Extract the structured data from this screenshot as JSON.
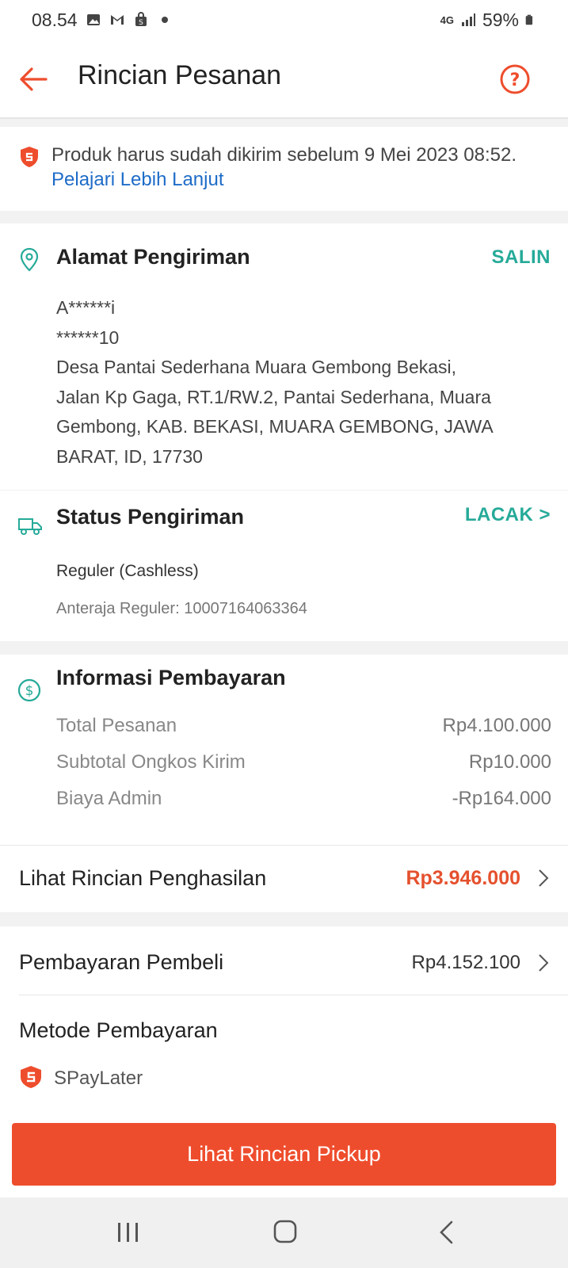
{
  "status_bar": {
    "time": "08.54",
    "network": "4G",
    "battery": "59%"
  },
  "header": {
    "title": "Rincian Pesanan"
  },
  "notice": {
    "text": "Produk harus sudah dikirim sebelum 9 Mei 2023 08:52.",
    "link": "Pelajari Lebih Lanjut"
  },
  "address": {
    "title": "Alamat Pengiriman",
    "action": "SALIN",
    "name": "A******i",
    "phone": "******10",
    "line1": "Desa Pantai Sederhana Muara Gembong Bekasi,",
    "line2": "Jalan Kp Gaga, RT.1/RW.2, Pantai Sederhana, Muara",
    "line3": "Gembong, KAB. BEKASI, MUARA GEMBONG, JAWA",
    "line4": "BARAT, ID, 17730"
  },
  "shipping": {
    "title": "Status Pengiriman",
    "action": "LACAK >",
    "method": "Reguler (Cashless)",
    "tracking": "Anteraja Reguler: 10007164063364"
  },
  "payment": {
    "title": "Informasi Pembayaran",
    "rows": [
      {
        "label": "Total Pesanan",
        "value": "Rp4.100.000"
      },
      {
        "label": "Subtotal Ongkos Kirim",
        "value": "Rp10.000"
      },
      {
        "label": "Biaya Admin",
        "value": "-Rp164.000"
      }
    ]
  },
  "earnings": {
    "label": "Lihat Rincian Penghasilan",
    "value": "Rp3.946.000"
  },
  "buyer": {
    "label": "Pembayaran Pembeli",
    "value": "Rp4.152.100",
    "method_title": "Metode Pembayaran",
    "method": "SPayLater"
  },
  "cta": {
    "label": "Lihat Rincian Pickup"
  },
  "colors": {
    "accent": "#ee4d2d",
    "teal": "#26aa99",
    "link": "#1e6cc8"
  }
}
